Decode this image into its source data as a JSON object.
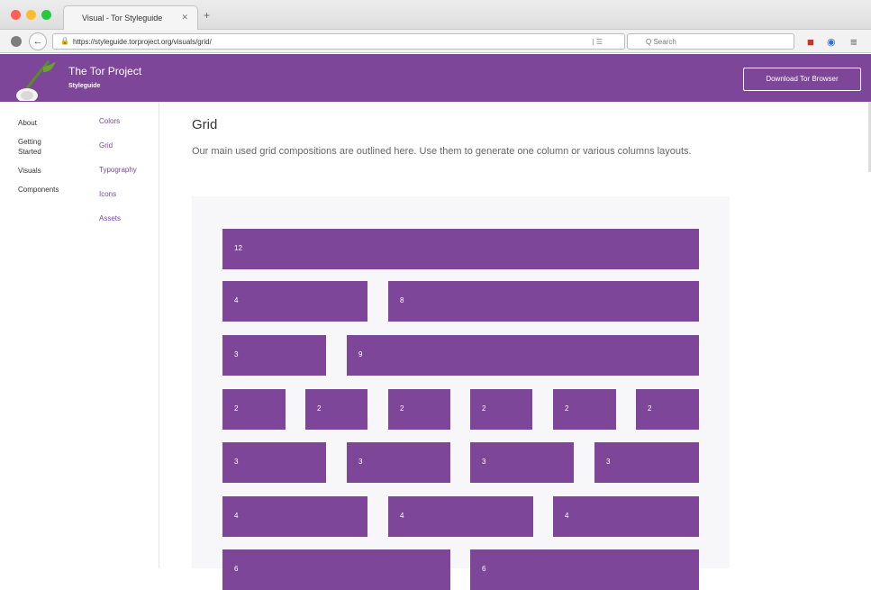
{
  "browser": {
    "tab_title": "Visual - Tor Styleguide",
    "tab_close": "✕",
    "new_tab": "+",
    "back_icon": "←",
    "url": "https://styleguide.torproject.org/visuals/grid/",
    "lock_icon": "🔒",
    "url_actions": "| ☰",
    "search_placeholder": "Q Search",
    "toolbar_icons": [
      "shield-icon",
      "globe-icon",
      "menu-icon"
    ]
  },
  "header": {
    "title": "The Tor Project",
    "subtitle": "Styleguide",
    "download_label": "Download Tor Browser"
  },
  "sidebar": {
    "primary": [
      "About",
      "Getting Started",
      "Visuals",
      "Components"
    ],
    "secondary": [
      "Colors",
      "Grid",
      "Typography",
      "Icons",
      "Assets"
    ]
  },
  "main": {
    "title": "Grid",
    "intro": "Our main used grid compositions are outlined here. Use them to generate one column or various columns layouts."
  },
  "grid_rows": [
    [
      "12"
    ],
    [
      "4",
      "8"
    ],
    [
      "3",
      "9"
    ],
    [
      "2",
      "2",
      "2",
      "2",
      "2",
      "2"
    ],
    [
      "3",
      "3",
      "3",
      "3"
    ],
    [
      "4",
      "4",
      "4"
    ],
    [
      "6",
      "6"
    ]
  ],
  "colors": {
    "brand": "#7d4698",
    "demo_bg": "#f7f7f9"
  }
}
